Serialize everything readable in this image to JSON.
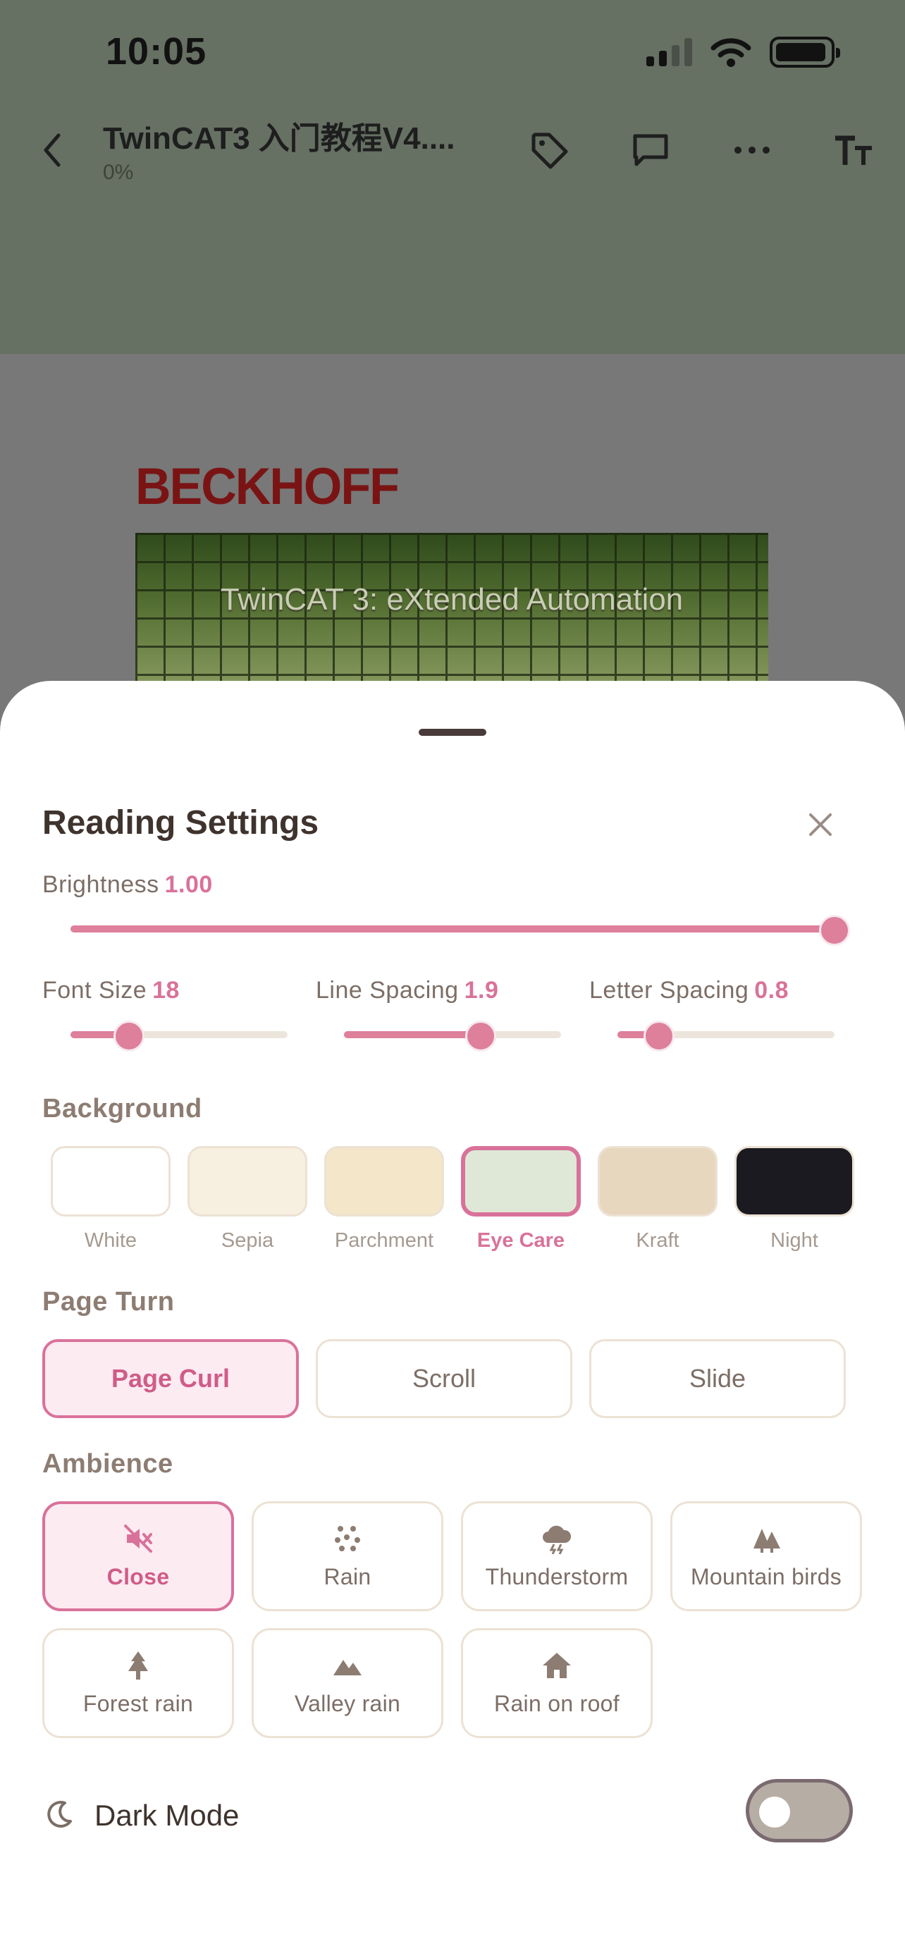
{
  "status_bar": {
    "time": "10:05"
  },
  "reader_header": {
    "title": "TwinCAT3 入门教程V4....",
    "progress": "0%",
    "icons": [
      "back-chevron-icon",
      "tag-icon",
      "comment-icon",
      "more-icon",
      "text-size-icon"
    ]
  },
  "document": {
    "brand": "BECKHOFF",
    "banner_text": "TwinCAT 3: eXtended Automation"
  },
  "sheet": {
    "title": "Reading Settings",
    "brightness": {
      "label": "Brightness",
      "value": "1.00",
      "level": 1.0
    },
    "font_size": {
      "label": "Font Size",
      "value": "18",
      "level": 0.27
    },
    "line_spacing": {
      "label": "Line Spacing",
      "value": "1.9",
      "level": 0.63
    },
    "letter_spacing": {
      "label": "Letter Spacing",
      "value": "0.8",
      "level": 0.19
    },
    "background": {
      "title": "Background",
      "selected": "Eye Care",
      "options": [
        {
          "label": "White",
          "color": "#ffffff"
        },
        {
          "label": "Sepia",
          "color": "#f7efdf"
        },
        {
          "label": "Parchment",
          "color": "#f4e6c9"
        },
        {
          "label": "Eye Care",
          "color": "#dfe8d6"
        },
        {
          "label": "Kraft",
          "color": "#e7d7be"
        },
        {
          "label": "Night",
          "color": "#1a1a20"
        }
      ]
    },
    "page_turn": {
      "title": "Page Turn",
      "selected": "Page Curl",
      "options": [
        "Page Curl",
        "Scroll",
        "Slide"
      ]
    },
    "ambience": {
      "title": "Ambience",
      "selected": "Close",
      "options": [
        {
          "label": "Close",
          "icon": "mute-speaker-icon"
        },
        {
          "label": "Rain",
          "icon": "rain-dots-icon"
        },
        {
          "label": "Thunderstorm",
          "icon": "thunder-cloud-icon"
        },
        {
          "label": "Mountain birds",
          "icon": "forest-icon"
        },
        {
          "label": "Forest rain",
          "icon": "tree-icon"
        },
        {
          "label": "Valley rain",
          "icon": "mountains-icon"
        },
        {
          "label": "Rain on roof",
          "icon": "house-icon"
        }
      ]
    },
    "dark_mode": {
      "label": "Dark Mode",
      "enabled": false
    }
  },
  "colors": {
    "accent": "#d9729a",
    "accent_bg": "#fcebf1",
    "text_primary": "#3f332e",
    "text_secondary": "#7c6e66"
  }
}
